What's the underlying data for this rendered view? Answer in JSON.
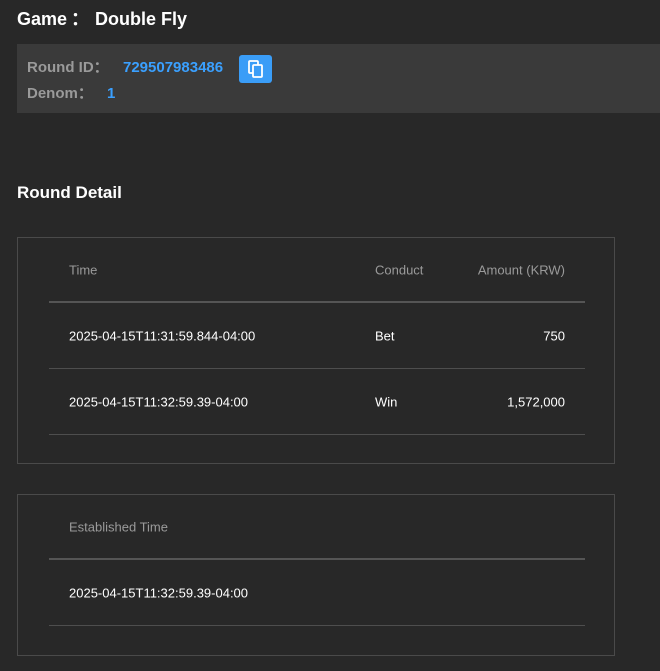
{
  "game": {
    "label": "Game",
    "separator": "：",
    "name": "Double Fly"
  },
  "round_info": {
    "round_id_label": "Round ID：",
    "round_id": "729507983486",
    "denom_label": "Denom：",
    "denom": "1",
    "copy_icon": "copy-icon"
  },
  "round_detail": {
    "title": "Round Detail",
    "headers": {
      "time": "Time",
      "conduct": "Conduct",
      "amount": "Amount (KRW)"
    },
    "rows": [
      {
        "time": "2025-04-15T11:31:59.844-04:00",
        "conduct": "Bet",
        "amount": "750"
      },
      {
        "time": "2025-04-15T11:32:59.39-04:00",
        "conduct": "Win",
        "amount": "1,572,000"
      }
    ]
  },
  "established": {
    "header": "Established Time",
    "value": "2025-04-15T11:32:59.39-04:00"
  },
  "colors": {
    "background": "#282828",
    "panel": "#3a3a3a",
    "accent": "#3aa0ff",
    "label": "#9a9a9a"
  }
}
